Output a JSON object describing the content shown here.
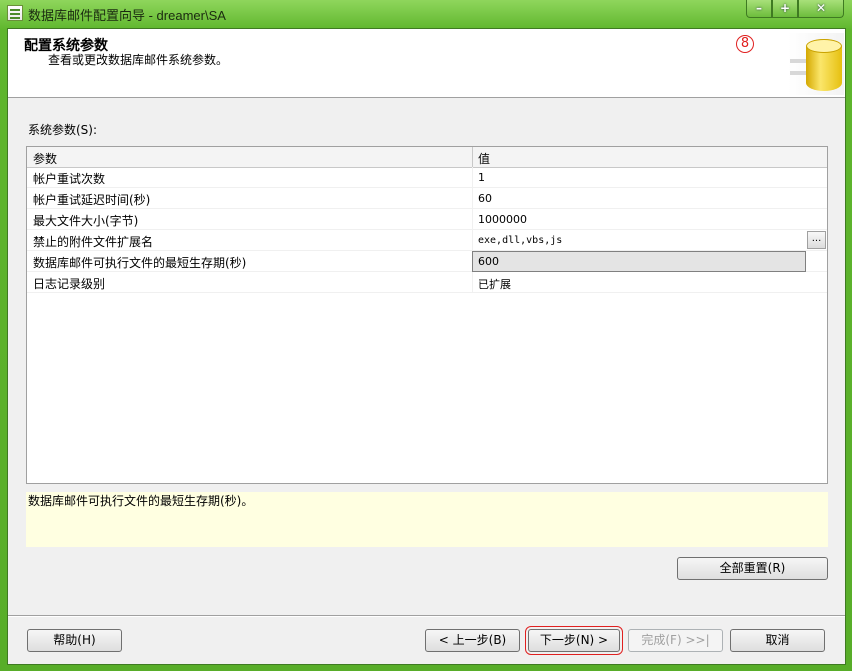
{
  "window": {
    "title": "数据库邮件配置向导 - dreamer\\SA",
    "controls": {
      "minimize": "–",
      "maximize": "+",
      "close": "✕"
    }
  },
  "header": {
    "title": "配置系统参数",
    "subtitle": "查看或更改数据库邮件系统参数。",
    "step_marker": "8"
  },
  "group_label": "系统参数(S):",
  "grid": {
    "columns": [
      "参数",
      "值"
    ],
    "rows": [
      {
        "name": "帐户重试次数",
        "value": "1"
      },
      {
        "name": "帐户重试延迟时间(秒)",
        "value": "60"
      },
      {
        "name": "最大文件大小(字节)",
        "value": "1000000"
      },
      {
        "name": "禁止的附件文件扩展名",
        "value": "exe,dll,vbs,js",
        "has_ellipsis": true,
        "ellipsis": "..."
      },
      {
        "name": "数据库邮件可执行文件的最短生存期(秒)",
        "value": "600",
        "selected": true
      },
      {
        "name": "日志记录级别",
        "value": "已扩展"
      }
    ]
  },
  "description": "数据库邮件可执行文件的最短生存期(秒)。",
  "buttons": {
    "reset_all": "全部重置(R)",
    "help": "帮助(H)",
    "back": "< 上一步(B)",
    "next": "下一步(N) >",
    "finish": "完成(F) >>|",
    "cancel": "取消"
  },
  "colors": {
    "frame": "#6cc43a",
    "description_bg": "#ffffe1",
    "annotation_red": "#e02020"
  }
}
